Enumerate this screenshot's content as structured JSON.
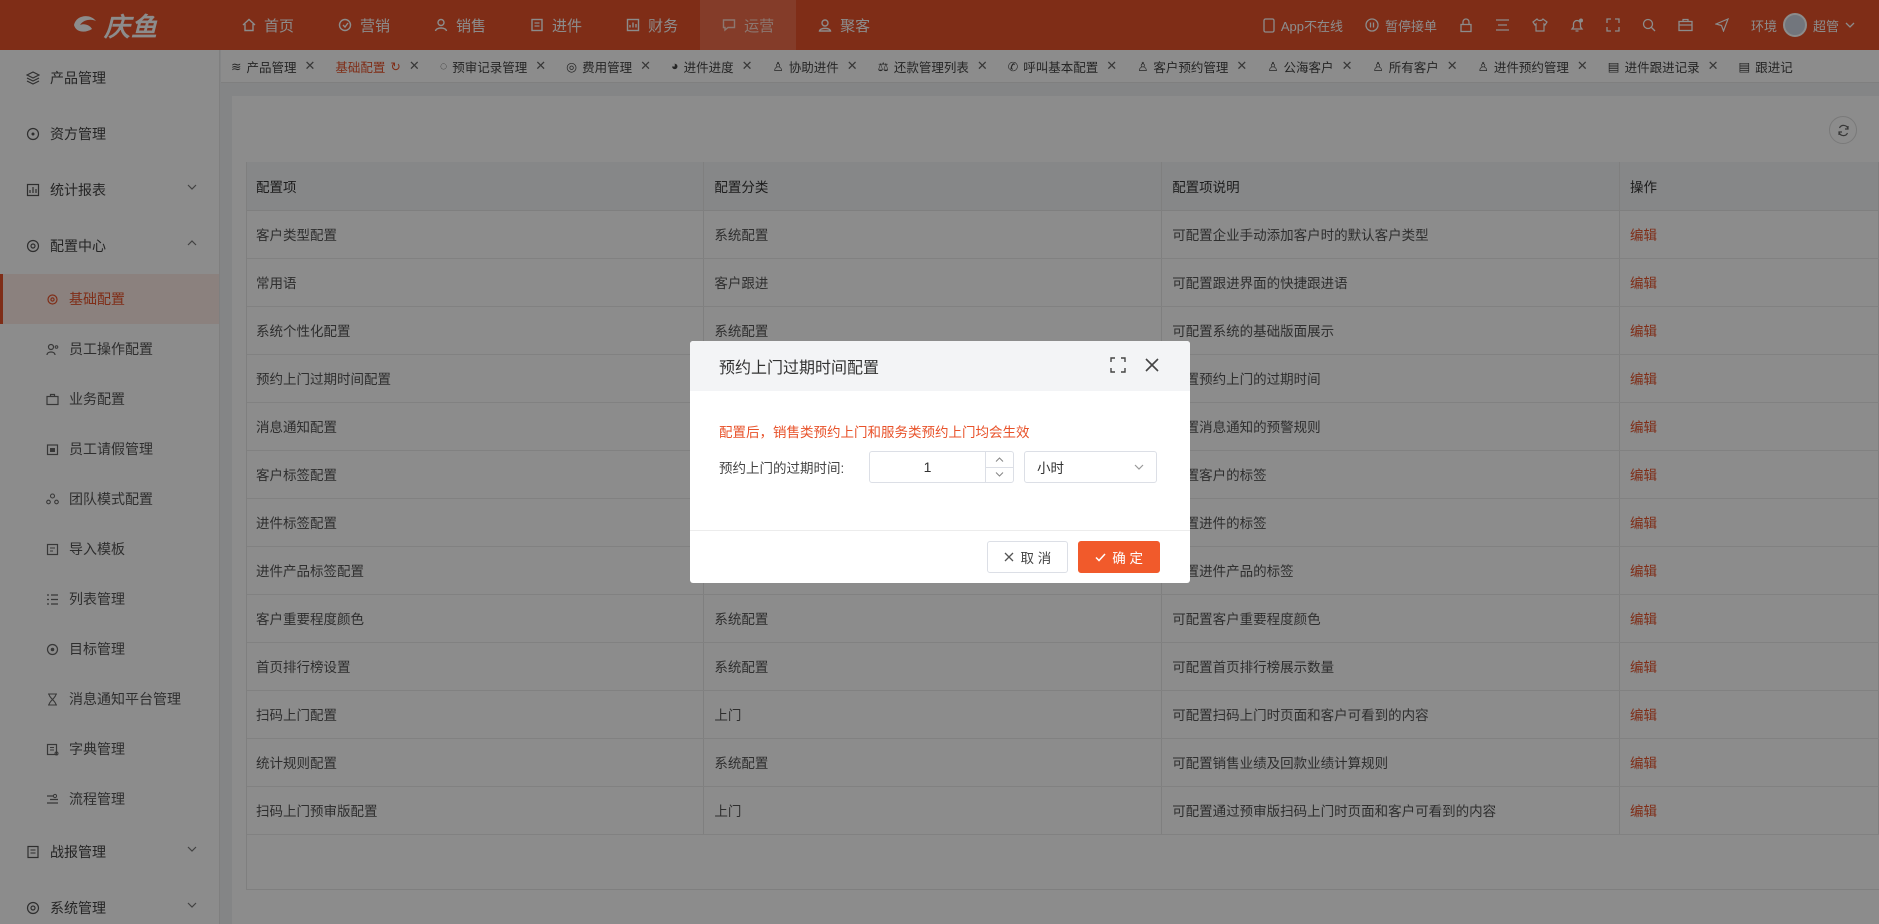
{
  "brand": {
    "name": "庆鱼"
  },
  "topnav": [
    {
      "label": "首页",
      "icon": "home-icon"
    },
    {
      "label": "营销",
      "icon": "marketing-icon"
    },
    {
      "label": "销售",
      "icon": "user-icon"
    },
    {
      "label": "进件",
      "icon": "document-icon"
    },
    {
      "label": "财务",
      "icon": "finance-icon"
    },
    {
      "label": "运营",
      "icon": "chat-icon",
      "active": true
    },
    {
      "label": "聚客",
      "icon": "group-icon"
    }
  ],
  "topright": {
    "app_status": "App不在线",
    "pause": "暂停接单",
    "user_env": "环境",
    "user_name": "超管"
  },
  "sidebar": {
    "items": [
      {
        "label": "产品管理"
      },
      {
        "label": "资方管理"
      },
      {
        "label": "统计报表"
      },
      {
        "label": "配置中心"
      }
    ],
    "sub": [
      {
        "label": "基础配置",
        "active": true
      },
      {
        "label": "员工操作配置"
      },
      {
        "label": "业务配置"
      },
      {
        "label": "员工请假管理"
      },
      {
        "label": "团队模式配置"
      },
      {
        "label": "导入模板"
      },
      {
        "label": "列表管理"
      },
      {
        "label": "目标管理"
      },
      {
        "label": "消息通知平台管理"
      },
      {
        "label": "字典管理"
      },
      {
        "label": "流程管理"
      }
    ],
    "bottom": [
      {
        "label": "战报管理"
      },
      {
        "label": "系统管理"
      }
    ]
  },
  "tabs": [
    {
      "label": "产品管理"
    },
    {
      "label": "基础配置",
      "active": true
    },
    {
      "label": "预审记录管理"
    },
    {
      "label": "费用管理"
    },
    {
      "label": "进件进度"
    },
    {
      "label": "协助进件"
    },
    {
      "label": "还款管理列表"
    },
    {
      "label": "呼叫基本配置"
    },
    {
      "label": "客户预约管理"
    },
    {
      "label": "公海客户"
    },
    {
      "label": "所有客户"
    },
    {
      "label": "进件预约管理"
    },
    {
      "label": "进件跟进记录"
    },
    {
      "label": "跟进记"
    }
  ],
  "table": {
    "headers": [
      "配置项",
      "配置分类",
      "配置项说明",
      "操作"
    ],
    "rows": [
      [
        "客户类型配置",
        "系统配置",
        "可配置企业手动添加客户时的默认客户类型",
        "编辑"
      ],
      [
        "常用语",
        "客户跟进",
        "可配置跟进界面的快捷跟进语",
        "编辑"
      ],
      [
        "系统个性化配置",
        "系统配置",
        "可配置系统的基础版面展示",
        "编辑"
      ],
      [
        "预约上门过期时间配置",
        "",
        "配置预约上门的过期时间",
        "编辑"
      ],
      [
        "消息通知配置",
        "",
        "配置消息通知的预警规则",
        "编辑"
      ],
      [
        "客户标签配置",
        "",
        "配置客户的标签",
        "编辑"
      ],
      [
        "进件标签配置",
        "",
        "配置进件的标签",
        "编辑"
      ],
      [
        "进件产品标签配置",
        "",
        "配置进件产品的标签",
        "编辑"
      ],
      [
        "客户重要程度颜色",
        "系统配置",
        "可配置客户重要程度颜色",
        "编辑"
      ],
      [
        "首页排行榜设置",
        "系统配置",
        "可配置首页排行榜展示数量",
        "编辑"
      ],
      [
        "扫码上门配置",
        "上门",
        "可配置扫码上门时页面和客户可看到的内容",
        "编辑"
      ],
      [
        "统计规则配置",
        "系统配置",
        "可配置销售业绩及回款业绩计算规则",
        "编辑"
      ],
      [
        "扫码上门预审版配置",
        "上门",
        "可配置通过预审版扫码上门时页面和客户可看到的内容",
        "编辑"
      ]
    ]
  },
  "modal": {
    "title": "预约上门过期时间配置",
    "warning": "配置后，销售类预约上门和服务类预约上门均会生效",
    "field_label": "预约上门的过期时间:",
    "value": "1",
    "unit": "小时",
    "cancel": "取 消",
    "ok": "确 定"
  },
  "colors": {
    "accent": "#e8522a",
    "danger": "#e8522a"
  }
}
